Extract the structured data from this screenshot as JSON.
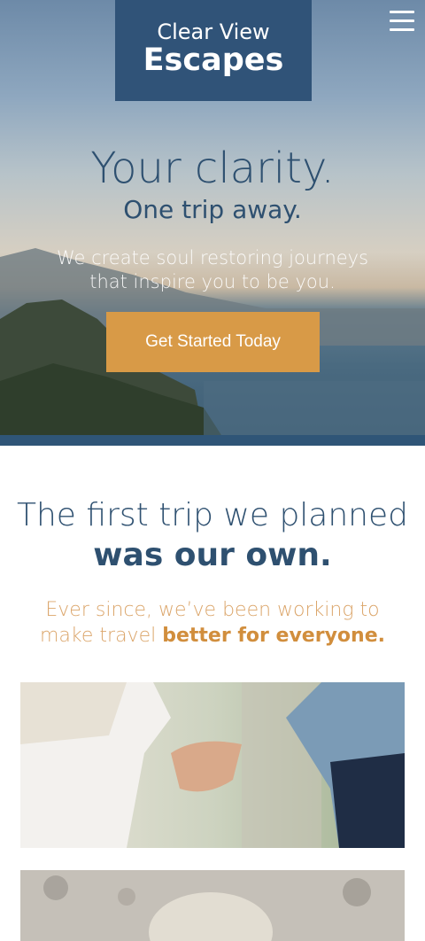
{
  "brand": {
    "line1": "Clear View",
    "line2": "Escapes"
  },
  "nav": {
    "menu_icon": "hamburger-menu-icon"
  },
  "hero": {
    "title": "Your clarity.",
    "subtitle": "One trip away.",
    "description": "We create soul restoring journeys that inspire you to be you.",
    "cta_label": "Get Started Today"
  },
  "intro": {
    "title_light": "The first trip we planned",
    "title_bold": "was our own.",
    "desc_light": "Ever since, we’ve been working to make travel ",
    "desc_bold": "better for everyone."
  },
  "colors": {
    "navy": "#305378",
    "gold": "#d89a47",
    "band": "#2f5577"
  }
}
